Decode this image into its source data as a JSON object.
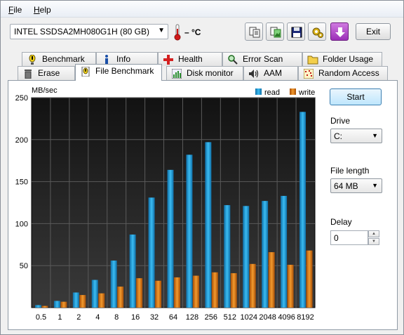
{
  "menu": {
    "file": "File",
    "file_key": "F",
    "help": "Help",
    "help_key": "H"
  },
  "toolbar": {
    "drive": "INTEL SSDSA2MH080G1H (80 GB)",
    "temperature": "– °C",
    "exit_label": "Exit"
  },
  "tabs_row1": [
    "Benchmark",
    "Info",
    "Health",
    "Error Scan",
    "Folder Usage"
  ],
  "tabs_row2": [
    "Erase",
    "File Benchmark",
    "Disk monitor",
    "AAM",
    "Random Access"
  ],
  "active_tab": "File Benchmark",
  "controls": {
    "start_label": "Start",
    "drive_label": "Drive",
    "drive_value": "C:",
    "file_length_label": "File length",
    "file_length_value": "64 MB",
    "delay_label": "Delay",
    "delay_value": "0"
  },
  "colors": {
    "read": "#1e9fd8",
    "write": "#e2780e",
    "plot_bg": "#1a1a1a",
    "grid": "#5a5a5a"
  },
  "chart_data": {
    "type": "bar",
    "ylabel": "MB/sec",
    "ylim": [
      0,
      250
    ],
    "yticks": [
      50,
      100,
      150,
      200,
      250
    ],
    "grid": true,
    "legend_position": "top-right",
    "categories": [
      "0.5",
      "1",
      "2",
      "4",
      "8",
      "16",
      "32",
      "64",
      "128",
      "256",
      "512",
      "1024",
      "2048",
      "4096",
      "8192"
    ],
    "series": [
      {
        "name": "read",
        "values": [
          3,
          8,
          18,
          33,
          56,
          87,
          131,
          164,
          182,
          197,
          122,
          121,
          127,
          133,
          233
        ]
      },
      {
        "name": "write",
        "values": [
          2,
          7,
          15,
          17,
          25,
          35,
          32,
          36,
          38,
          42,
          41,
          52,
          66,
          51,
          68
        ]
      }
    ]
  }
}
